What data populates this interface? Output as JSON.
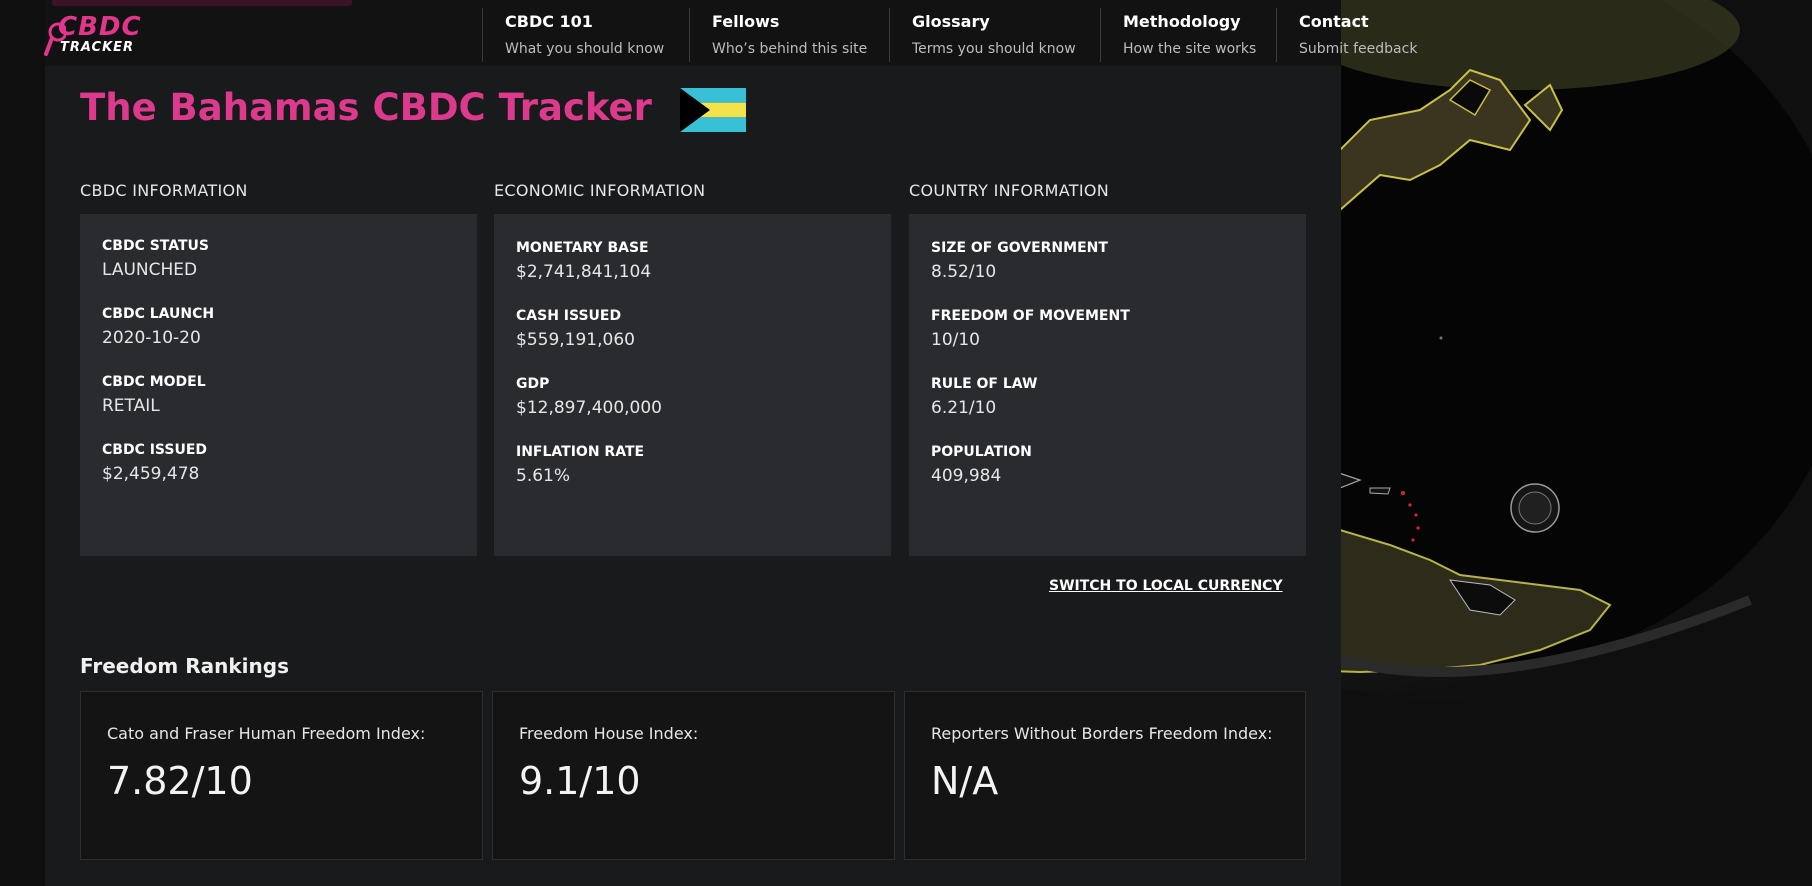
{
  "logo": {
    "line1": "CBDC",
    "line2": "TRACKER"
  },
  "nav": [
    {
      "title": "CBDC 101",
      "sub": "What you should know"
    },
    {
      "title": "Fellows",
      "sub": "Who’s behind this site"
    },
    {
      "title": "Glossary",
      "sub": "Terms you should know"
    },
    {
      "title": "Methodology",
      "sub": "How the site works"
    },
    {
      "title": "Contact",
      "sub": "Submit feedback"
    }
  ],
  "page_title": "The Bahamas CBDC Tracker",
  "sections": {
    "cbdc": {
      "heading": "CBDC INFORMATION",
      "rows": [
        {
          "label": "CBDC STATUS",
          "value": "LAUNCHED"
        },
        {
          "label": "CBDC LAUNCH",
          "value": "2020-10-20"
        },
        {
          "label": "CBDC MODEL",
          "value": "RETAIL"
        },
        {
          "label": "CBDC ISSUED",
          "value": "$2,459,478"
        }
      ]
    },
    "economic": {
      "heading": "ECONOMIC INFORMATION",
      "rows": [
        {
          "label": "MONETARY BASE",
          "value": "$2,741,841,104"
        },
        {
          "label": "CASH ISSUED",
          "value": "$559,191,060"
        },
        {
          "label": "GDP",
          "value": "$12,897,400,000"
        },
        {
          "label": "INFLATION RATE",
          "value": "5.61%"
        }
      ]
    },
    "country": {
      "heading": "COUNTRY INFORMATION",
      "rows": [
        {
          "label": "SIZE OF GOVERNMENT",
          "value": "8.52/10"
        },
        {
          "label": "FREEDOM OF MOVEMENT",
          "value": "10/10"
        },
        {
          "label": "RULE OF LAW",
          "value": "6.21/10"
        },
        {
          "label": "POPULATION",
          "value": "409,984"
        }
      ]
    }
  },
  "switch_currency": "SWITCH TO LOCAL CURRENCY",
  "rankings": {
    "heading": "Freedom Rankings",
    "cards": [
      {
        "label": "Cato and Fraser Human Freedom Index:",
        "value": "7.82/10"
      },
      {
        "label": "Freedom House Index:",
        "value": "9.1/10"
      },
      {
        "label": "Reporters Without Borders Freedom Index:",
        "value": "N/A"
      }
    ]
  },
  "colors": {
    "accent": "#de3a8d",
    "card": "#2a2b2f",
    "panel": "#191a1c"
  },
  "flag_colors": {
    "aquamarine": "#38c0d6",
    "gold": "#f3e24a",
    "black": "#000000"
  }
}
